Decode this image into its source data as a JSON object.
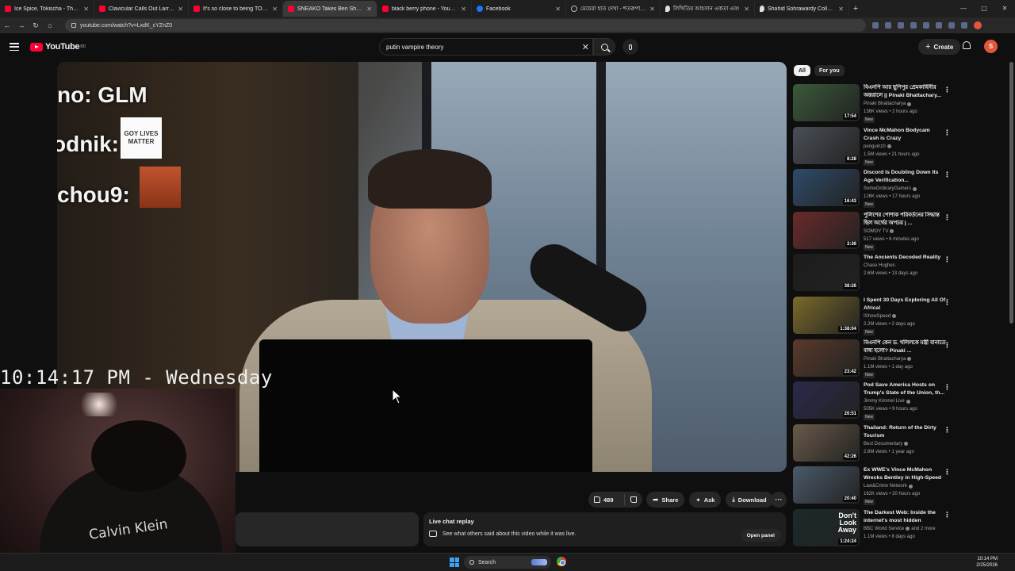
{
  "browser": {
    "tabs": [
      {
        "title": "Ice Spice, Tokischa - Thootie - Y",
        "favicon": "youtube-icon",
        "active": false
      },
      {
        "title": "Clavicular Calls Out Larry When",
        "favicon": "youtube-icon",
        "active": false
      },
      {
        "title": "It's so close to being TOTALLY",
        "favicon": "youtube-icon",
        "active": false
      },
      {
        "title": "SNEAKO Takes Ben Shapiro",
        "favicon": "youtube-icon",
        "active": true
      },
      {
        "title": "black berry phone - YouTube",
        "favicon": "youtube-icon",
        "active": false
      },
      {
        "title": "Facebook",
        "favicon": "facebook-icon",
        "active": false
      },
      {
        "title": "মেয়েরা হাত দেখা - শতরুপা ডেকো",
        "favicon": "globe-icon",
        "active": false
      },
      {
        "title": "লিখিতিয় আহসান একতা এবং",
        "favicon": "pin-icon",
        "active": false
      },
      {
        "title": "Shahid Sohrawardy College, Kh",
        "favicon": "pin-icon",
        "active": false
      }
    ],
    "url": "youtube.com/watch?v=LxdK_cYZnZ0"
  },
  "youtube": {
    "logo_text": "YouTube",
    "logo_country": "BD",
    "search_query": "putin vampire theory",
    "create_label": "Create",
    "user_initial": "S"
  },
  "video_overlay": {
    "chat": [
      {
        "text": "no: GLM"
      },
      {
        "text": "odnik:"
      },
      {
        "text": "chou9:"
      }
    ],
    "emote_text": "GOY LIVES MATTER",
    "clock": "10:14:17 PM - Wednesday",
    "webcam_shirt_text": "Calvin Klein"
  },
  "actions": {
    "likes": "489",
    "share": "Share",
    "ask": "Ask",
    "download": "Download"
  },
  "live_chat": {
    "heading": "Live chat replay",
    "subtext": "See what others said about this video while it was live.",
    "button": "Open panel"
  },
  "chips": [
    "All",
    "For you"
  ],
  "recommendations": [
    {
      "title": "বিএনপি আর ছুপিপুর প্রেমকাহিনীর অন্তরালে || Pinaki Bhattachary...",
      "channel": "Pinaki Bhattacharya",
      "verified": true,
      "stats": "136K views • 2 hours ago",
      "new": true,
      "duration": "17:54",
      "color": "#3a5a3a"
    },
    {
      "title": "Vince McMahon Bodycam Crash is Crazy",
      "channel": "penguinz0",
      "verified": true,
      "stats": "1.5M views • 21 hours ago",
      "new": true,
      "duration": "8:28",
      "color": "#4a4f57"
    },
    {
      "title": "Discord Is Doubling Down Its Age Verification...",
      "channel": "SomeOrdinaryGamers",
      "verified": true,
      "stats": "126K views • 17 hours ago",
      "new": true,
      "duration": "16:43",
      "color": "#2f4b6a"
    },
    {
      "title": "পুলিশের পোশাক পরিবর্তনের সিদ্ধান্ত ছিল অর্থের অপচয় | ...",
      "channel": "SOMOY TV",
      "verified": true,
      "stats": "517 views • 6 minutes ago",
      "new": true,
      "duration": "3:36",
      "color": "#6a2a2a"
    },
    {
      "title": "The Ancients Decoded Reality",
      "channel": "Chase Hughes",
      "verified": false,
      "stats": "2.6M views • 13 days ago",
      "new": false,
      "duration": "38:26",
      "color": "#1c1c1c"
    },
    {
      "title": "I Spent 30 Days Exploring All Of Africa!",
      "channel": "IShowSpeed",
      "verified": true,
      "stats": "2.2M views • 2 days ago",
      "new": true,
      "duration": "1:38:04",
      "color": "#7a6a2a"
    },
    {
      "title": "বিএনপি কেন ড. খলিলকে মন্ত্রী বানাতে বাধ্য হলো? Pinaki ...",
      "channel": "Pinaki Bhattacharya",
      "verified": true,
      "stats": "1.1M views • 1 day ago",
      "new": true,
      "duration": "23:42",
      "color": "#5a3a2a"
    },
    {
      "title": "Pod Save America Hosts on Trump's State of the Union, th...",
      "channel": "Jimmy Kimmel Live",
      "verified": true,
      "stats": "505K views • 9 hours ago",
      "new": true,
      "duration": "20:51",
      "color": "#2a2a4a"
    },
    {
      "title": "Thailand: Return of the Dirty Tourism",
      "channel": "Best Documentary",
      "verified": true,
      "stats": "2.8M views • 1 year ago",
      "new": false,
      "duration": "42:26",
      "color": "#6a5a4a"
    },
    {
      "title": "Ex WWE's Vince McMahon Wrecks Bentley in High-Speed ...",
      "channel": "Law&Crime Network",
      "verified": true,
      "stats": "162K views • 20 hours ago",
      "new": true,
      "duration": "20:40",
      "color": "#4a5a6a"
    },
    {
      "title": "The Darkest Web: Inside the internet's most hidden corners...",
      "channel": "BBC World Service",
      "verified": true,
      "stats_extra": "and 2 more",
      "stats": "1.1M views • 8 days ago",
      "new": false,
      "duration": "1:24:24",
      "color": "#1a2a2a",
      "overlay_text": "Don't Look Away"
    }
  ],
  "taskbar": {
    "search_label": "Search",
    "time": "10:14 PM",
    "date": "2/25/2026"
  }
}
